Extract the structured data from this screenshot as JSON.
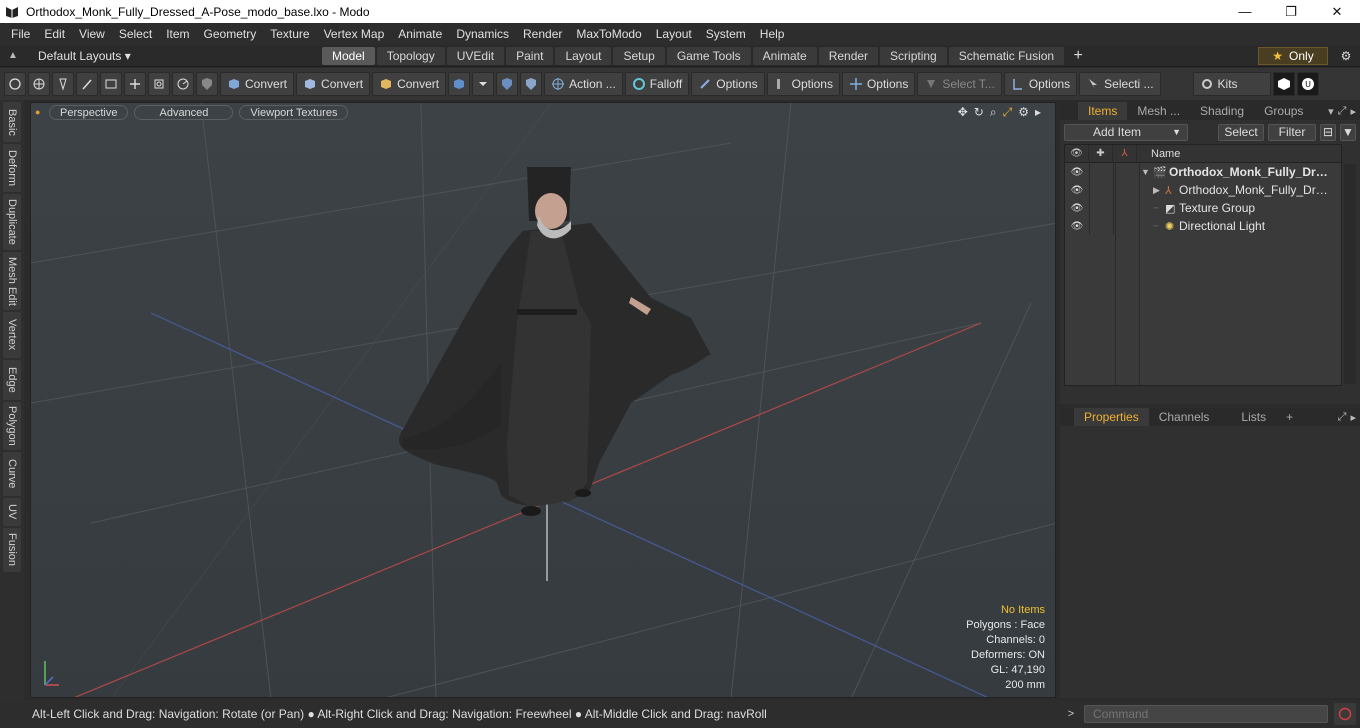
{
  "window": {
    "title": "Orthodox_Monk_Fully_Dressed_A-Pose_modo_base.lxo - Modo",
    "minimize": "—",
    "maximize": "❐",
    "close": "✕"
  },
  "menu": [
    "File",
    "Edit",
    "View",
    "Select",
    "Item",
    "Geometry",
    "Texture",
    "Vertex Map",
    "Animate",
    "Dynamics",
    "Render",
    "MaxToModo",
    "Layout",
    "System",
    "Help"
  ],
  "layouts": {
    "label": "Default Layouts ▾",
    "tabs": [
      "Model",
      "Topology",
      "UVEdit",
      "Paint",
      "Layout",
      "Setup",
      "Game Tools",
      "Animate",
      "Render",
      "Scripting",
      "Schematic Fusion"
    ],
    "active_tab": "Model",
    "plus": "+",
    "only_label": "Only"
  },
  "toolbar": {
    "convert1": "Convert",
    "convert2": "Convert",
    "convert3": "Convert",
    "action": "Action ...",
    "falloff": "Falloff",
    "options1": "Options",
    "options2": "Options",
    "options3": "Options",
    "select_t": "Select T...",
    "options4": "Options",
    "selecti": "Selecti ...",
    "kits": "Kits"
  },
  "left_tabs": [
    "Basic",
    "Deform",
    "Duplicate",
    "Mesh Edit",
    "Vertex",
    "Edge",
    "Polygon",
    "Curve",
    "UV",
    "Fusion"
  ],
  "viewport": {
    "perspective": "Perspective",
    "advanced": "Advanced",
    "textures": "Viewport Textures",
    "info": {
      "no_items": "No Items",
      "polygons": "Polygons : Face",
      "channels": "Channels: 0",
      "deformers": "Deformers: ON",
      "gl": "GL: 47,190",
      "size": "200 mm"
    }
  },
  "items_panel": {
    "tabs": [
      "Items",
      "Mesh ...",
      "Shading",
      "Groups"
    ],
    "add_item": "Add Item",
    "select": "Select",
    "filter": "Filter",
    "name_header": "Name",
    "rows": [
      {
        "name": "Orthodox_Monk_Fully_Dr ..."
      },
      {
        "name": "Orthodox_Monk_Fully_Dres ..."
      },
      {
        "name": "Texture Group"
      },
      {
        "name": "Directional Light"
      }
    ]
  },
  "properties_panel": {
    "tabs": [
      "Properties",
      "Channels",
      "Lists"
    ],
    "plus": "+"
  },
  "status": {
    "hint": "Alt-Left Click and Drag: Navigation: Rotate (or Pan) ● Alt-Right Click and Drag: Navigation: Freewheel ● Alt-Middle Click and Drag: navRoll",
    "command_placeholder": "Command"
  }
}
